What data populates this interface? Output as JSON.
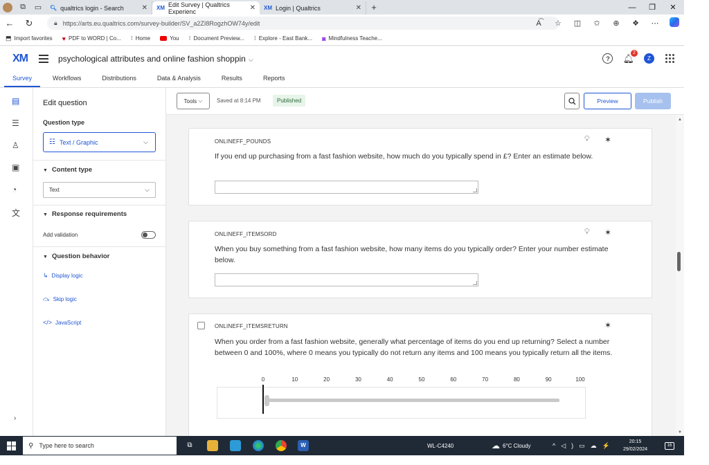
{
  "browser": {
    "tabs": [
      {
        "label": "qualtrics login - Search",
        "icon": "search-icon"
      },
      {
        "label": "Edit Survey | Qualtrics Experienc",
        "icon": "xm-icon"
      },
      {
        "label": "Login | Qualtrics",
        "icon": "xm-icon"
      }
    ],
    "url": "https://arts.eu.qualtrics.com/survey-builder/SV_a2ZI8RogzhOW74y/edit",
    "bookmarks": [
      "Import favorites",
      "PDF to WORD | Co...",
      "Home",
      "You",
      "Document Preview...",
      "Explore - East Bank...",
      "Mindfulness Teache..."
    ]
  },
  "header": {
    "logo": "XM",
    "survey_title": "psychological attributes and online fashion shoppin",
    "notification_count": "2",
    "user_initial": "Z"
  },
  "main_tabs": [
    "Survey",
    "Workflows",
    "Distributions",
    "Data & Analysis",
    "Results",
    "Reports"
  ],
  "panel": {
    "title": "Edit question",
    "question_type_label": "Question type",
    "question_type_value": "Text / Graphic",
    "content_type_label": "Content type",
    "content_type_value": "Text",
    "response_requirements_label": "Response requirements",
    "add_validation_label": "Add validation",
    "question_behavior_label": "Question behavior",
    "display_logic": "Display logic",
    "skip_logic": "Skip logic",
    "javascript": "JavaScript"
  },
  "toolbar": {
    "tools": "Tools",
    "saved": "Saved at 8:14 PM",
    "status": "Published",
    "preview": "Preview",
    "publish": "Publish"
  },
  "questions": [
    {
      "id": "ONLINEFF_POUNDS",
      "text": "If you end up purchasing from a fast fashion website, how much do you typically spend in £? Enter an estimate below."
    },
    {
      "id": "ONLINEFF_ITEMSORD",
      "text": "When you buy something from a fast fashion website, how many items do you typically order? Enter your number estimate below."
    },
    {
      "id": "ONLINEFF_ITEMSRETURN",
      "text": "When you order from a fast fashion website, generally what percentage of items do you end up returning? Select a number between 0 and 100%, where 0 means you typically do not return any items and 100 means you typically return all the items.",
      "slider_ticks": [
        "0",
        "10",
        "20",
        "30",
        "40",
        "50",
        "60",
        "70",
        "80",
        "90",
        "100"
      ],
      "slider_value": 0
    }
  ],
  "taskbar": {
    "search_placeholder": "Type here to search",
    "network": "WL-C4240",
    "weather": "6°C  Cloudy",
    "time": "20:15",
    "date": "29/02/2024",
    "notifications": "16"
  }
}
